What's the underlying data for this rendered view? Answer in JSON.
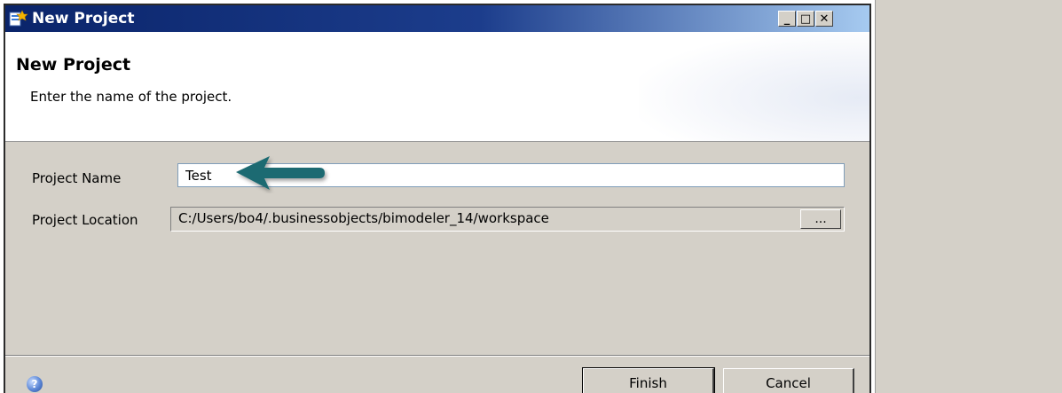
{
  "window": {
    "title": "New Project",
    "icon": "new-project-app-icon",
    "controls": {
      "minimize": "_",
      "maximize": "□",
      "close": "✕"
    }
  },
  "header": {
    "title": "New Project",
    "description": "Enter the name of the project."
  },
  "form": {
    "project_name": {
      "label": "Project Name",
      "value": "Test"
    },
    "project_location": {
      "label": "Project Location",
      "value": "C:/Users/bo4/.businessobjects/bimodeler_14/workspace",
      "browse_label": "..."
    }
  },
  "annotation": {
    "arrow_color": "#1f6b72"
  },
  "footer": {
    "help_icon": "help-icon",
    "help_glyph": "?",
    "finish_label": "Finish",
    "cancel_label": "Cancel"
  },
  "colors": {
    "title_gradient_start": "#0a246a",
    "title_gradient_end": "#a6caf0",
    "dialog_bg": "#d4d0c8"
  }
}
